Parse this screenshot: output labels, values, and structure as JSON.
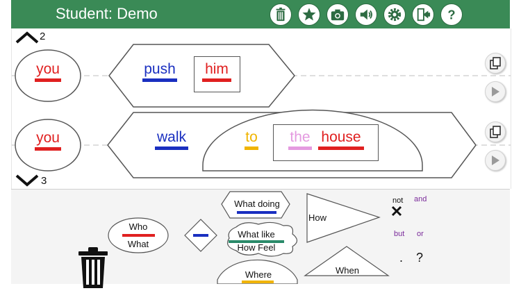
{
  "header": {
    "title": "Student: Demo",
    "bg_color": "#3a8a56",
    "icons": [
      "trash-icon",
      "star-icon",
      "camera-icon",
      "speaker-icon",
      "gear-icon",
      "exit-icon",
      "help-icon"
    ]
  },
  "nav": {
    "up_count": "2",
    "down_count": "3"
  },
  "sentences": [
    {
      "who": "you",
      "verb": "push",
      "object": "him"
    },
    {
      "who": "you",
      "verb": "walk",
      "prep": "to",
      "article": "the",
      "noun": "house"
    }
  ],
  "palette": {
    "who": "Who",
    "what": "What",
    "what_doing": "What doing",
    "what_like": "What like",
    "how_feel": "How Feel",
    "where": "Where",
    "how": "How",
    "when": "When",
    "not": "not",
    "and": "and",
    "but": "but",
    "or": "or",
    "period": ".",
    "question": "?"
  },
  "colors": {
    "who": "#e02020",
    "verb": "#1a2fc0",
    "prep": "#f0b400",
    "article": "#e49ae0",
    "describe": "#2a8a6a",
    "conj": "#7a2a9a"
  }
}
